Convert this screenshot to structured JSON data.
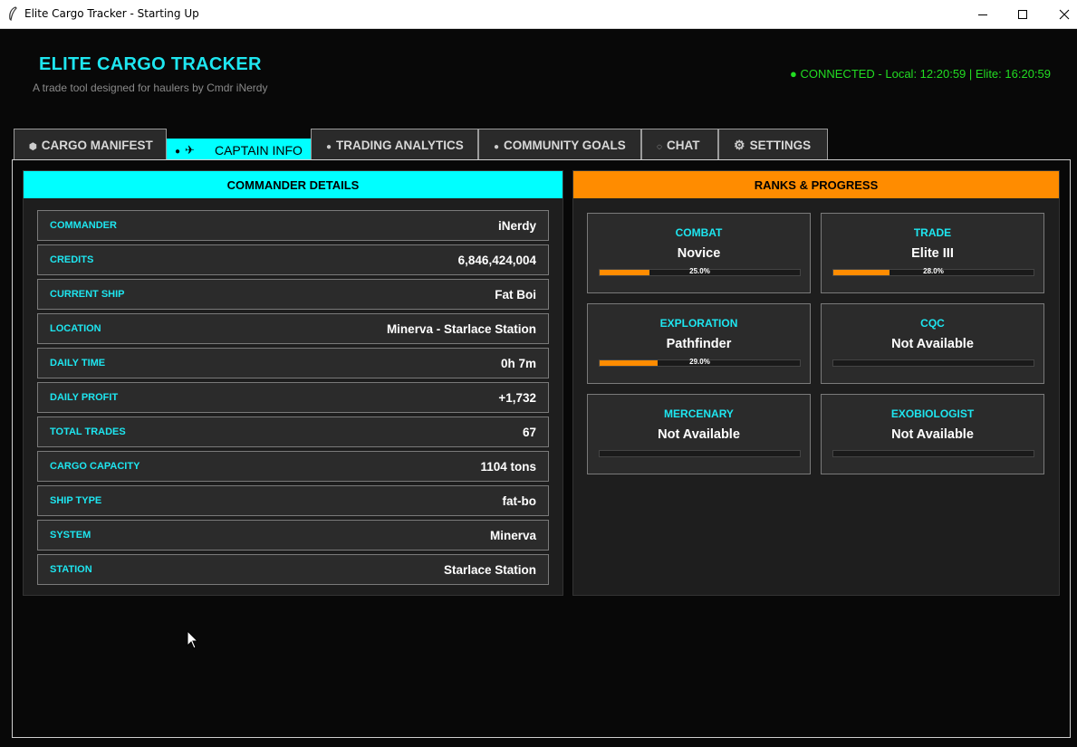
{
  "window": {
    "title": "Elite Cargo Tracker - Starting Up"
  },
  "header": {
    "title": "ELITE CARGO TRACKER",
    "subtitle": "A trade tool designed for haulers by Cmdr iNerdy",
    "status": "● CONNECTED - Local: 12:20:59 | Elite: 16:20:59",
    "status_color": "#22dd22"
  },
  "tabs": [
    {
      "label": "CARGO MANIFEST",
      "icon": "box-icon"
    },
    {
      "label": "CAPTAIN INFO",
      "icon": "plane-icon",
      "active": true
    },
    {
      "label": "TRADING ANALYTICS",
      "icon": "money-bag-icon"
    },
    {
      "label": "COMMUNITY GOALS",
      "icon": "target-icon"
    },
    {
      "label": "CHAT",
      "icon": "chat-bubble-icon"
    },
    {
      "label": "SETTINGS",
      "icon": "gear-icon"
    }
  ],
  "commander_panel": {
    "title": "COMMANDER DETAILS",
    "header_color": "#00ffff",
    "rows": [
      {
        "label": "COMMANDER",
        "value": "iNerdy"
      },
      {
        "label": "CREDITS",
        "value": "6,846,424,004"
      },
      {
        "label": "CURRENT SHIP",
        "value": "Fat Boi"
      },
      {
        "label": "LOCATION",
        "value": "Minerva - Starlace Station"
      },
      {
        "label": "DAILY TIME",
        "value": "0h 7m"
      },
      {
        "label": "DAILY PROFIT",
        "value": "+1,732"
      },
      {
        "label": "TOTAL TRADES",
        "value": "67"
      },
      {
        "label": "CARGO CAPACITY",
        "value": "1104 tons"
      },
      {
        "label": "SHIP TYPE",
        "value": "fat-bo"
      },
      {
        "label": "SYSTEM",
        "value": "Minerva"
      },
      {
        "label": "STATION",
        "value": "Starlace Station"
      }
    ]
  },
  "ranks_panel": {
    "title": "RANKS & PROGRESS",
    "header_color": "#ff8c00",
    "ranks": [
      {
        "name": "COMBAT",
        "rank": "Novice",
        "progress": 0.25,
        "pct_label": "25.0%"
      },
      {
        "name": "TRADE",
        "rank": "Elite III",
        "progress": 0.28,
        "pct_label": "28.0%"
      },
      {
        "name": "EXPLORATION",
        "rank": "Pathfinder",
        "progress": 0.29,
        "pct_label": "29.0%"
      },
      {
        "name": "CQC",
        "rank": "Not Available",
        "progress": 0,
        "pct_label": ""
      },
      {
        "name": "MERCENARY",
        "rank": "Not Available",
        "progress": 0,
        "pct_label": ""
      },
      {
        "name": "EXOBIOLOGIST",
        "rank": "Not Available",
        "progress": 0,
        "pct_label": ""
      }
    ]
  }
}
